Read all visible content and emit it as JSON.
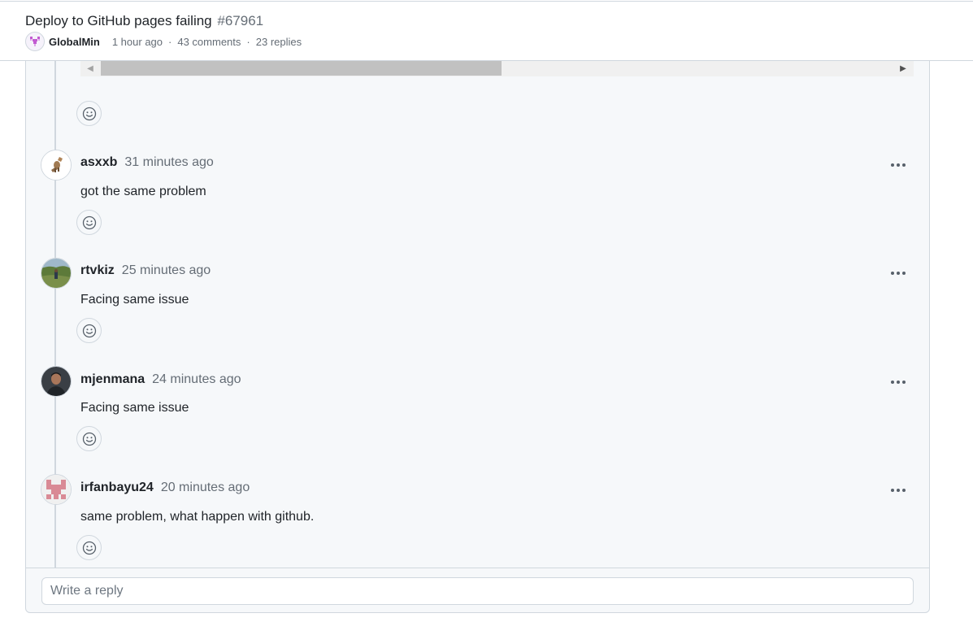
{
  "discussion": {
    "title": "Deploy to GitHub pages failing",
    "number": "#67961",
    "author": "GlobalMin",
    "created": "1 hour ago",
    "comments": "43 comments",
    "replies": "23 replies",
    "separator": "·"
  },
  "scrollbar": {
    "left_arrow": "◀",
    "right_arrow": "▶"
  },
  "replies": [
    {
      "author": "asxxb",
      "time": "31 minutes ago",
      "body": "got the same problem"
    },
    {
      "author": "rtvkiz",
      "time": "25 minutes ago",
      "body": "Facing same issue"
    },
    {
      "author": "mjenmana",
      "time": "24 minutes ago",
      "body": "Facing same issue"
    },
    {
      "author": "irfanbayu24",
      "time": "20 minutes ago",
      "body": "same problem, what happen with github."
    }
  ],
  "reply_box": {
    "placeholder": "Write a reply"
  },
  "icons": {
    "reaction": "smiley-icon",
    "more": "kebab-horizontal-icon"
  },
  "colors": {
    "panel_bg": "#f6f8fa",
    "border": "#d0d7de",
    "muted_text": "#656d76",
    "text": "#1f2328"
  }
}
